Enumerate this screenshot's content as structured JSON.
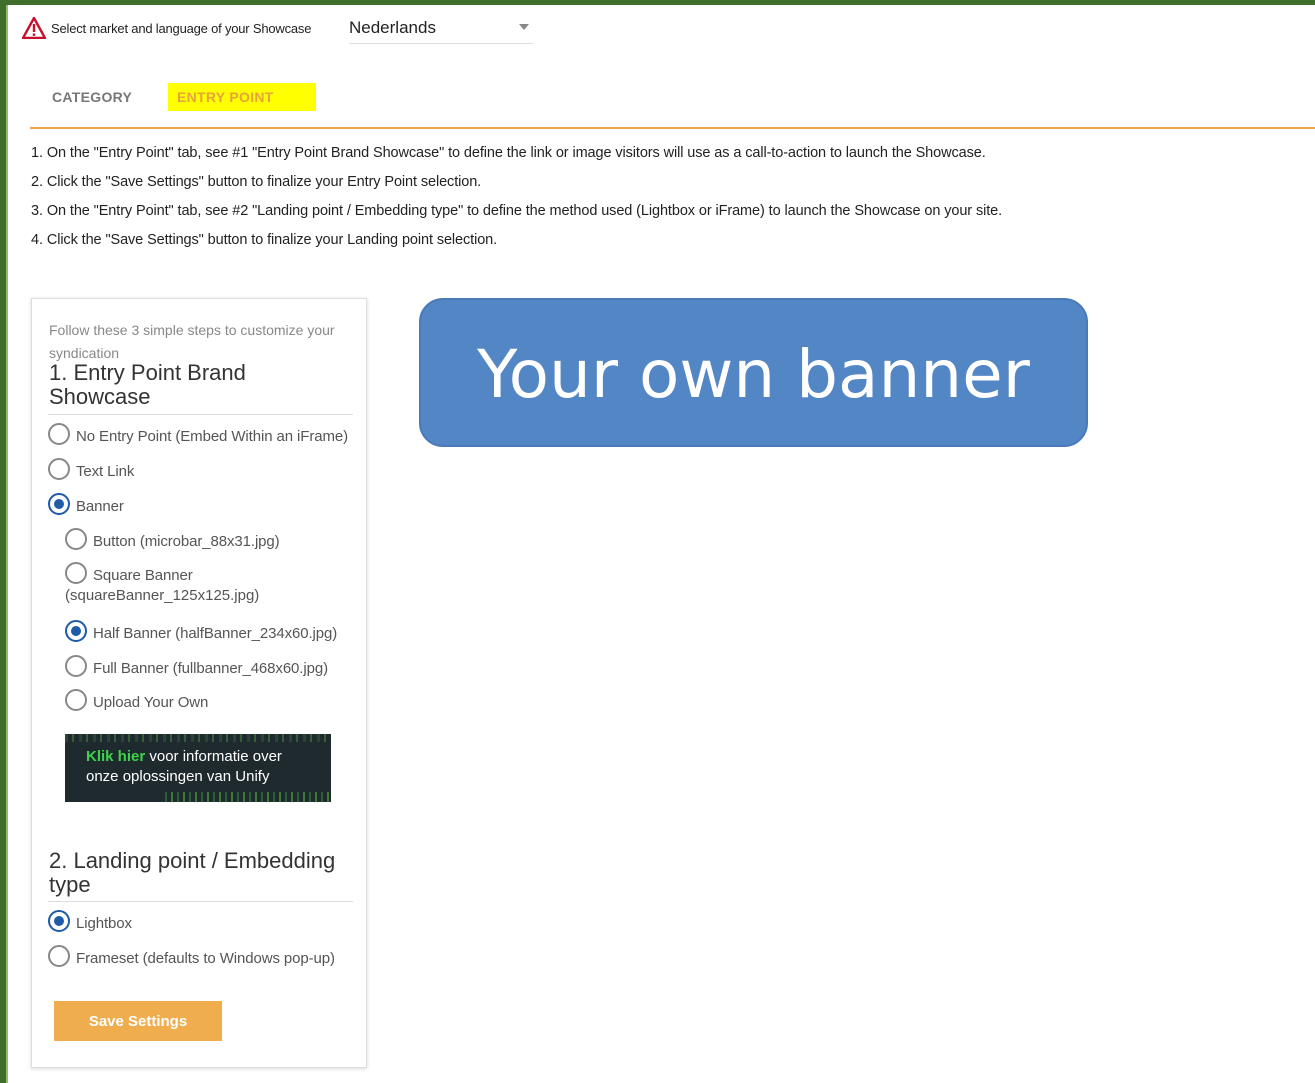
{
  "market": {
    "label": "Select market and language of your Showcase",
    "selected_language": "Nederlands"
  },
  "tabs": [
    {
      "label": "CATEGORY",
      "active": false
    },
    {
      "label": "ENTRY POINT",
      "active": true
    }
  ],
  "instructions": [
    "1. On the \"Entry Point\" tab, see #1 \"Entry Point Brand Showcase\" to define the link or image visitors will use as a call-to-action to launch the Showcase.",
    "2. Click the \"Save Settings\" button to finalize your Entry Point selection.",
    "3. On the \"Entry Point\" tab, see #2 \"Landing point / Embedding type\" to define the method used (Lightbox or iFrame) to launch the Showcase on your site.",
    "4. Click the \"Save Settings\" button to finalize your Landing point selection."
  ],
  "panel": {
    "intro": "Follow these 3 simple steps to customize your syndication",
    "section1_title": "1. Entry Point Brand Showcase",
    "entry_options": [
      {
        "label": "No Entry Point (Embed Within an iFrame)",
        "checked": false
      },
      {
        "label": "Text Link",
        "checked": false
      },
      {
        "label": "Banner",
        "checked": true
      }
    ],
    "banner_options": [
      {
        "label": "Button (microbar_88x31.jpg)",
        "checked": false
      },
      {
        "label": "Square Banner",
        "label_cont": "(squareBanner_125x125.jpg)",
        "checked": false
      },
      {
        "label": "Half Banner (halfBanner_234x60.jpg)",
        "checked": true
      },
      {
        "label": "Full Banner (fullbanner_468x60.jpg)",
        "checked": false
      },
      {
        "label": "Upload Your Own",
        "checked": false
      }
    ],
    "promo": {
      "highlight": "Klik hier",
      "line1_rest": " voor informatie over",
      "line2": "onze oplossingen van Unify"
    },
    "section2_title": "2. Landing point / Embedding type",
    "landing_options": [
      {
        "label": "Lightbox",
        "checked": true
      },
      {
        "label": "Frameset (defaults to Windows pop-up)",
        "checked": false
      }
    ],
    "save_label": "Save Settings"
  },
  "banner_preview": {
    "text": "Your own banner",
    "color": "#5386c4"
  },
  "colors": {
    "accent": "#efa745",
    "radio_checked": "#1f5ba8",
    "tab_highlight": "#ffff00"
  },
  "icons": {
    "warning": "warning-triangle-icon",
    "dropdown": "chevron-down-icon"
  }
}
